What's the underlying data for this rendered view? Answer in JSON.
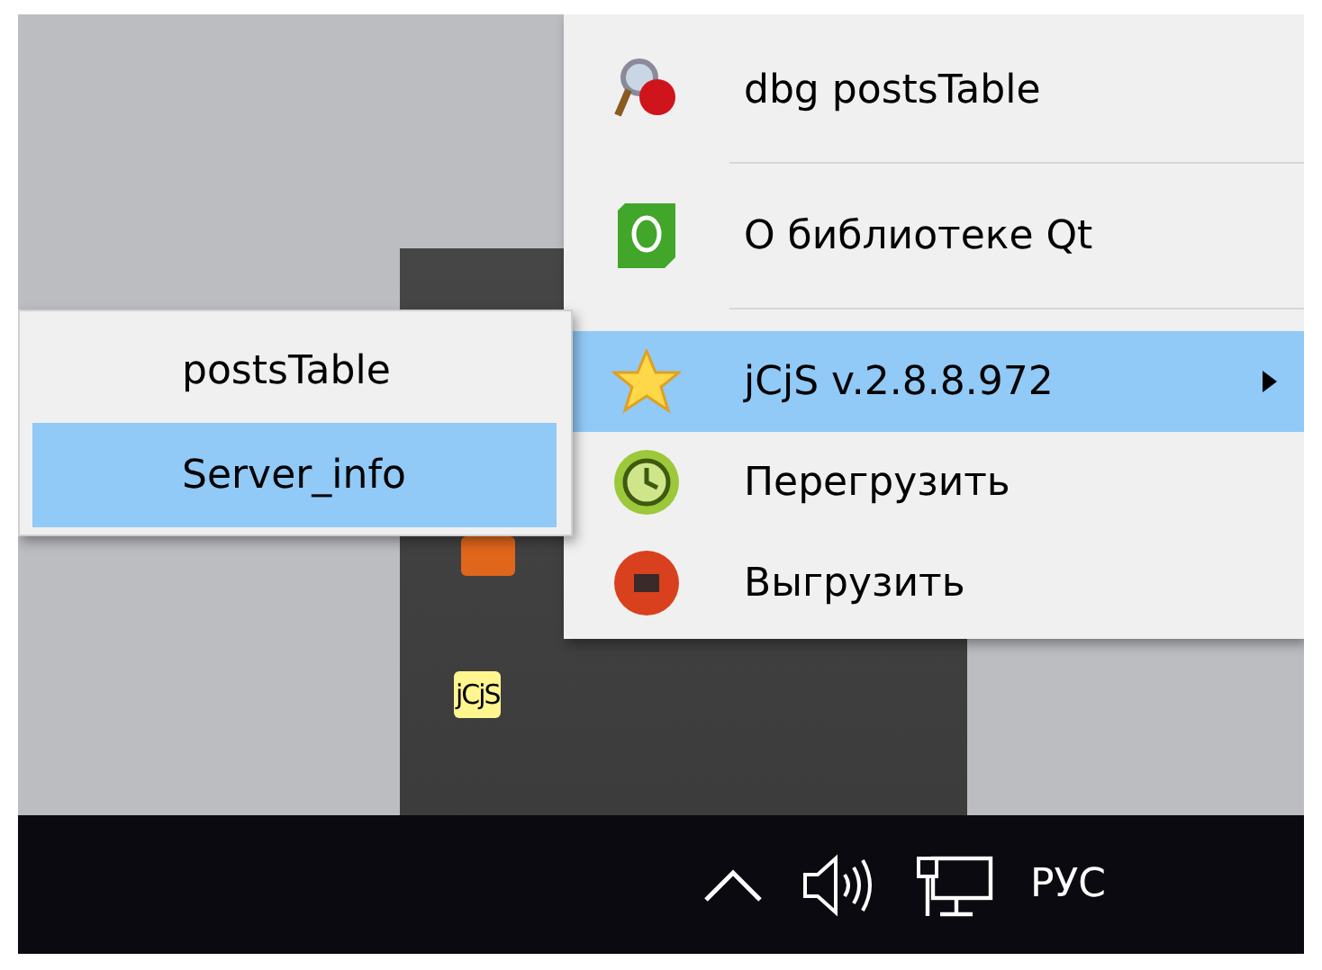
{
  "menu": {
    "items": [
      {
        "kind": "item",
        "label": "dbg postsTable",
        "selected": false,
        "submenu": false
      },
      {
        "kind": "separator"
      },
      {
        "kind": "item",
        "label": "О библиотеке Qt",
        "selected": false,
        "submenu": false
      },
      {
        "kind": "separator"
      },
      {
        "kind": "item",
        "label": "jCjS v.2.8.8.972",
        "selected": true,
        "submenu": true
      },
      {
        "kind": "item",
        "label": "Перегрузить",
        "selected": false,
        "submenu": false
      },
      {
        "kind": "item",
        "label": "Выгрузить",
        "selected": false,
        "submenu": false
      }
    ]
  },
  "submenu": {
    "items": [
      {
        "label": "postsTable",
        "selected": false
      },
      {
        "label": "Server_info",
        "selected": true
      }
    ]
  },
  "tray_flyout": {
    "app_icon_text": "jCjS"
  },
  "taskbar": {
    "language": "РУС"
  }
}
